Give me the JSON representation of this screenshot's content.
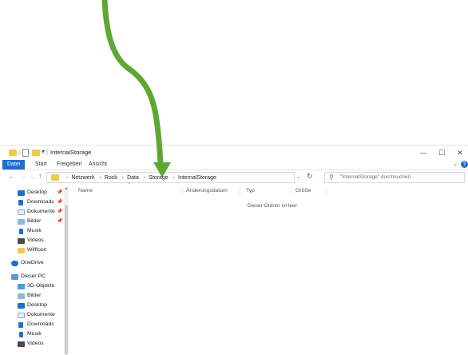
{
  "colors": {
    "accent": "#1e6fd0",
    "arrow": "#5ea832",
    "folder": "#f2c94c"
  },
  "window": {
    "title": "InternalStorage",
    "controls": {
      "minimize": "—",
      "maximize": "☐",
      "close": "✕"
    }
  },
  "ribbon": {
    "tabs": [
      "Datei",
      "Start",
      "Freigeben",
      "Ansicht"
    ],
    "expand": "⌄",
    "help": "?"
  },
  "navigation": {
    "back": "←",
    "forward": "→",
    "recent": "⌄",
    "up": "↑",
    "breadcrumb": [
      "Netzwerk",
      "Rock",
      "Data",
      "Storage",
      "InternalStorage"
    ],
    "dropdown": "⌄",
    "refresh": "↻"
  },
  "search": {
    "placeholder": "\"InternalStorage\" durchsuchen"
  },
  "sidebar": {
    "items": [
      {
        "label": "Desktop",
        "icon": "desktop-icon",
        "pinned": true
      },
      {
        "label": "Downloads",
        "icon": "download-icon",
        "pinned": true
      },
      {
        "label": "Dokumente",
        "icon": "documents-icon",
        "pinned": true
      },
      {
        "label": "Bilder",
        "icon": "pictures-icon",
        "pinned": true
      },
      {
        "label": "Musik",
        "icon": "music-icon",
        "pinned": false
      },
      {
        "label": "Videos",
        "icon": "videos-icon",
        "pinned": false
      },
      {
        "label": "Wiffloon",
        "icon": "folder-icon",
        "pinned": false
      },
      {
        "label": "OneDrive",
        "icon": "onedrive-icon",
        "pinned": false
      },
      {
        "label": "Dieser PC",
        "icon": "pc-icon",
        "pinned": false
      },
      {
        "label": "3D-Objekte",
        "icon": "3d-objects-icon",
        "pinned": false
      },
      {
        "label": "Bilder",
        "icon": "pictures-icon",
        "pinned": false
      },
      {
        "label": "Desktop",
        "icon": "desktop-icon",
        "pinned": false
      },
      {
        "label": "Dokumente",
        "icon": "documents-icon",
        "pinned": false
      },
      {
        "label": "Downloads",
        "icon": "download-icon",
        "pinned": false
      },
      {
        "label": "Musik",
        "icon": "music-icon",
        "pinned": false
      },
      {
        "label": "Videos",
        "icon": "videos-icon",
        "pinned": false
      }
    ]
  },
  "filelist": {
    "columns": [
      "Name",
      "Änderungsdatum",
      "Typ",
      "Größe"
    ],
    "empty_message": "Dieser Ordner ist leer."
  }
}
